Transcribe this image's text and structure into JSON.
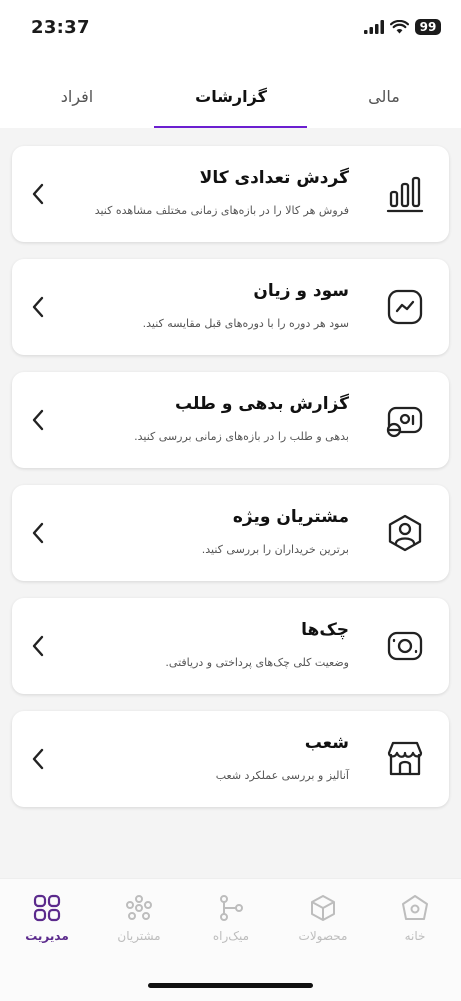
{
  "status_bar": {
    "time": "23:37",
    "battery": "99"
  },
  "tabs": [
    {
      "label": "مالی",
      "active": false
    },
    {
      "label": "گزارشات",
      "active": true
    },
    {
      "label": "افراد",
      "active": false
    }
  ],
  "accent_color": "#6b1fd0",
  "cards": [
    {
      "title": "گردش تعدادی کالا",
      "description": "فروش هر کالا را در بازه‌های زمانی مختلف مشاهده کنید",
      "icon": "bar-chart-icon"
    },
    {
      "title": "سود و زیان",
      "description": "سود هر دوره را با دوره‌های قبل مقایسه کنید.",
      "icon": "line-chart-icon"
    },
    {
      "title": "گزارش بدهی و طلب",
      "description": "بدهی و طلب را در بازه‌های زمانی بررسی کنید.",
      "icon": "money-icon"
    },
    {
      "title": "مشتریان ویژه",
      "description": "برترین خریداران را بررسی کنید.",
      "icon": "user-badge-icon"
    },
    {
      "title": "چک‌ها",
      "description": "وضعیت کلی چک‌های پرداختی و دریافتی.",
      "icon": "cheque-icon"
    },
    {
      "title": "شعب",
      "description": "آنالیز و بررسی عملکرد شعب",
      "icon": "shop-icon"
    }
  ],
  "bottom_nav": [
    {
      "label": "خانه",
      "icon": "home-icon",
      "active": false
    },
    {
      "label": "محصولات",
      "icon": "box-icon",
      "active": false
    },
    {
      "label": "میک‌راه",
      "icon": "git-branch-icon",
      "active": false
    },
    {
      "label": "مشتریان",
      "icon": "customers-icon",
      "active": false
    },
    {
      "label": "مدیریت",
      "icon": "grid-icon",
      "active": true
    }
  ]
}
